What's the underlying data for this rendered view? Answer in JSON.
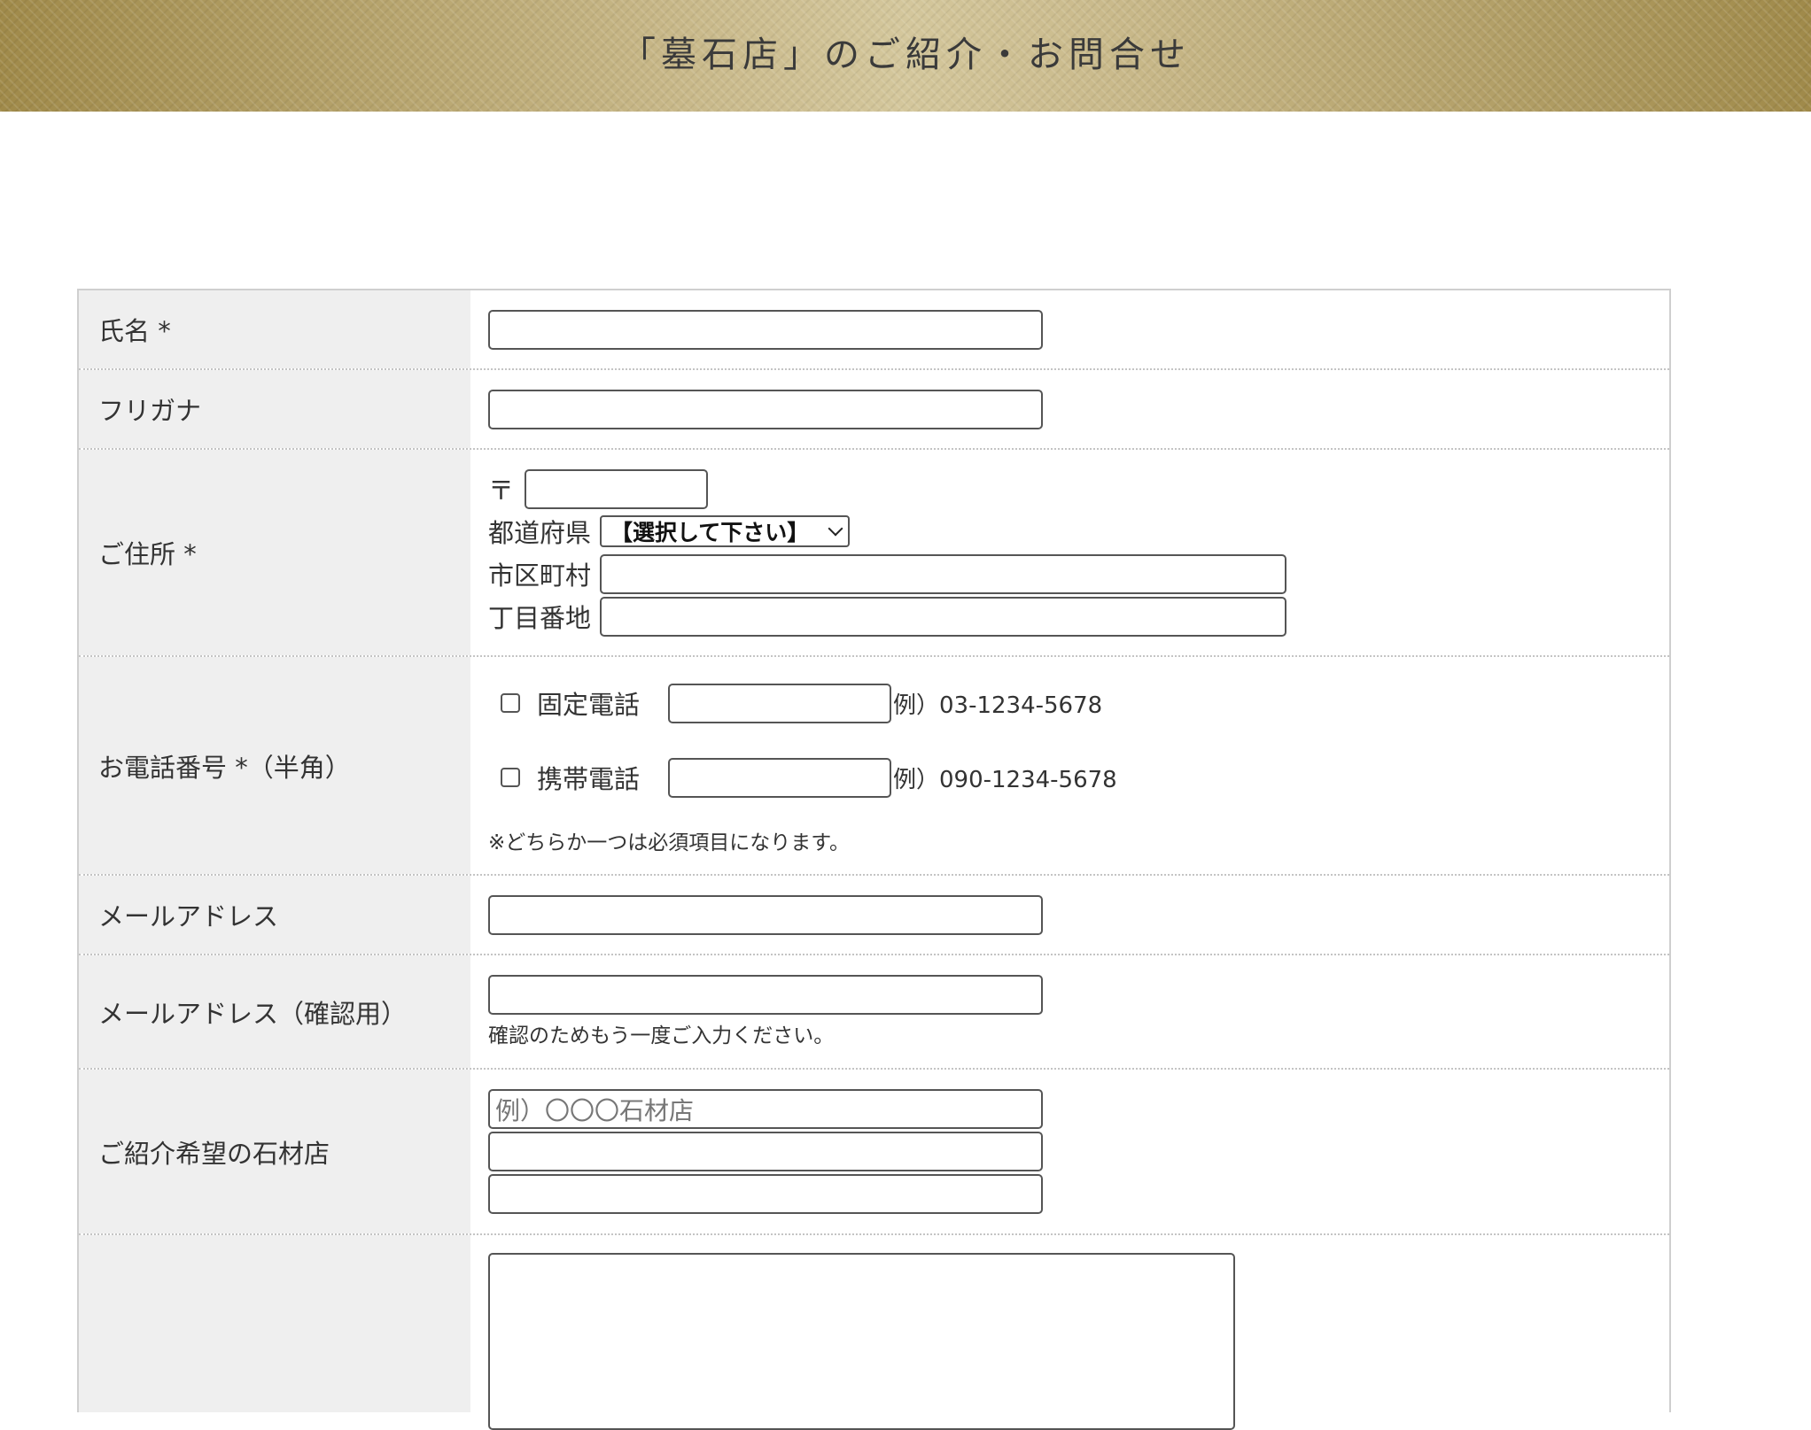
{
  "header": {
    "title": "「墓石店」のご紹介・お問合せ"
  },
  "form": {
    "name": {
      "label": "氏名 *",
      "value": ""
    },
    "furigana": {
      "label": "フリガナ",
      "value": ""
    },
    "address": {
      "label": "ご住所 *",
      "postal_mark": "〒",
      "postal_value": "",
      "prefecture_label": "都道府県",
      "prefecture_selected": "【選択して下さい】",
      "city_label": "市区町村",
      "city_value": "",
      "street_label": "丁目番地",
      "street_value": ""
    },
    "phone": {
      "label": "お電話番号 *（半角）",
      "landline_label": "固定電話",
      "landline_example": "例）03-1234-5678",
      "mobile_label": "携帯電話",
      "mobile_example": "例）090-1234-5678",
      "note": "※どちらか一つは必須項目になります。"
    },
    "email": {
      "label": "メールアドレス",
      "value": ""
    },
    "email_confirm": {
      "label": "メールアドレス（確認用）",
      "value": "",
      "note": "確認のためもう一度ご入力ください。"
    },
    "shop": {
      "label": "ご紹介希望の石材店",
      "placeholder": "例）〇〇〇石材店"
    },
    "message": {
      "label": ""
    }
  }
}
